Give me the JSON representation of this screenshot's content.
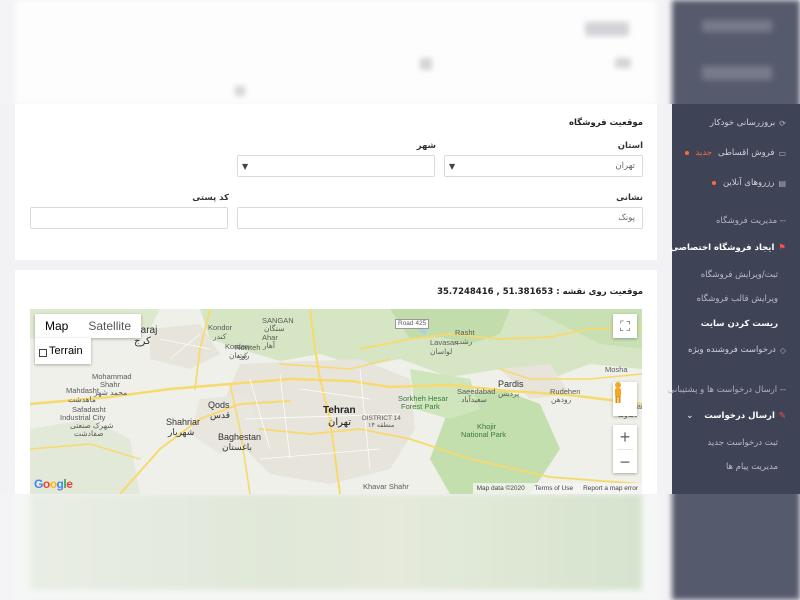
{
  "sidebar": {
    "items": [
      {
        "label": "بروزرسانی خودکار",
        "icon": "refresh-icon"
      },
      {
        "label": "فروش اقساطی",
        "badge": "جدید",
        "icon": "card-icon"
      },
      {
        "label": "رزروهای آنلاین",
        "icon": "calendar-icon"
      }
    ],
    "section_store": "-- مدیریت فروشگاه",
    "create_store": "ایجاد فروشگاه اختصاصی",
    "sub_register": "ثبت/ویرایش فروشگاه",
    "sub_template": "ویرایش قالب فروشگاه",
    "reset_site": "ریست کردن سایت",
    "special_seller": "درخواست فروشنده ویژه",
    "section_support": "-- ارسال درخواست ها و پشتیبانی",
    "send_request": "ارسال درخواست",
    "new_request": "ثبت درخواست جدید",
    "messages": "مدیریت پیام ها"
  },
  "location_form": {
    "title": "موقعیت فروشگاه",
    "province_label": "استان",
    "province_value": "تهران",
    "city_label": "شهر",
    "city_value": "",
    "address_label": "نشانی",
    "address_value": "پونک",
    "postal_label": "کد پستی",
    "postal_value": ""
  },
  "map_section": {
    "label": "موقعیت روی نقشه :",
    "coordinates": "35.7248416 , 51.381653",
    "map_tab": "Map",
    "satellite_tab": "Satellite",
    "terrain_label": "Terrain",
    "google": "Google",
    "attribution": [
      "Map data ©2020",
      "Terms of Use",
      "Report a map error"
    ],
    "labels": {
      "karaj": "Karaj",
      "karaj_fa": "کرج",
      "mohammad_shahr": "Mohammad",
      "mohammad_shahr2": "Shahr",
      "mohammad_shahr_fa": "محمد شهر",
      "mahdasht": "Mahdasht",
      "mahdasht_fa": "ماهدشت",
      "safadasht": "Safadasht",
      "safadasht2": "Industrial City",
      "safadasht_fa": "شهرک صنعتی",
      "safadasht_fa2": "صفادشت",
      "kondor": "Kondor",
      "kondor_fa": "کندر",
      "kordan": "Kordan",
      "kordan_fa": "کردان",
      "sangan": "SANGAN",
      "sangan_fa": "سنگان",
      "ahar": "Ahar",
      "ahar_fa": "آهار",
      "rowteh": "Rowteh",
      "rowteh_fa": "روته",
      "lavasan": "Lavasan",
      "lavasan_fa": "لواسان",
      "rasht": "Rasht",
      "rasht_fa": "رشت",
      "road": "Road 425",
      "qods": "Qods",
      "qods_fa": "قدس",
      "shahriar": "Shahriar",
      "shahriar_fa": "شهریار",
      "baghestan": "Baghestan",
      "baghestan_fa": "باغستان",
      "tehran": "Tehran",
      "tehran_fa": "تهران",
      "district": "DISTRICT 14",
      "district_fa": "منطقه ۱۴",
      "sorkhe": "Sorkheh Hesar",
      "sorkhe2": "Forest Park",
      "khojir": "Khojir",
      "khojir2": "National Park",
      "saeedabad": "Saeedabad",
      "saeedabad_fa": "سعیدآباد",
      "pardis": "Pardis",
      "pardis_fa": "پردیس",
      "rudehen": "Rudehen",
      "rudehen_fa": "رودهن",
      "mosha": "Mosha",
      "damavand": "Damavand",
      "damavand_fa": "دماوند",
      "khavar": "Khavar Shahr"
    }
  },
  "colors": {
    "sidebar_bg": "#3f4356",
    "accent_orange": "#ff6a3d",
    "flag_red": "#ff4d4d",
    "road_yellow": "#f8d96b",
    "park_green": "#c4dfae",
    "urban_grey": "#e7e5df"
  }
}
